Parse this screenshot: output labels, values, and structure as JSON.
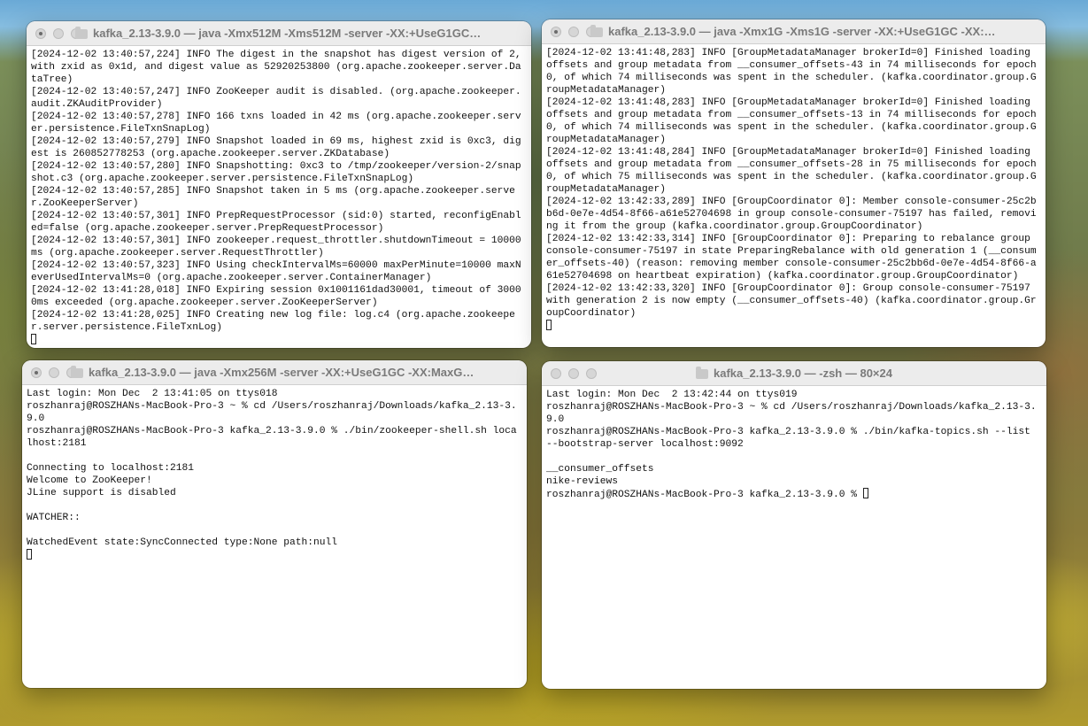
{
  "windows": [
    {
      "title": "kafka_2.13-3.9.0 — java -Xmx512M -Xms512M -server -XX:+UseG1GC -X...",
      "lines": [
        "[2024-12-02 13:40:57,224] INFO The digest in the snapshot has digest version of 2, with zxid as 0x1d, and digest value as 52920253800 (org.apache.zookeeper.server.DataTree)",
        "[2024-12-02 13:40:57,247] INFO ZooKeeper audit is disabled. (org.apache.zookeeper.audit.ZKAuditProvider)",
        "[2024-12-02 13:40:57,278] INFO 166 txns loaded in 42 ms (org.apache.zookeeper.server.persistence.FileTxnSnapLog)",
        "[2024-12-02 13:40:57,279] INFO Snapshot loaded in 69 ms, highest zxid is 0xc3, digest is 260852778253 (org.apache.zookeeper.server.ZKDatabase)",
        "[2024-12-02 13:40:57,280] INFO Snapshotting: 0xc3 to /tmp/zookeeper/version-2/snapshot.c3 (org.apache.zookeeper.server.persistence.FileTxnSnapLog)",
        "[2024-12-02 13:40:57,285] INFO Snapshot taken in 5 ms (org.apache.zookeeper.server.ZooKeeperServer)",
        "[2024-12-02 13:40:57,301] INFO PrepRequestProcessor (sid:0) started, reconfigEnabled=false (org.apache.zookeeper.server.PrepRequestProcessor)",
        "[2024-12-02 13:40:57,301] INFO zookeeper.request_throttler.shutdownTimeout = 10000 ms (org.apache.zookeeper.server.RequestThrottler)",
        "[2024-12-02 13:40:57,323] INFO Using checkIntervalMs=60000 maxPerMinute=10000 maxNeverUsedIntervalMs=0 (org.apache.zookeeper.server.ContainerManager)",
        "[2024-12-02 13:41:28,018] INFO Expiring session 0x1001161dad30001, timeout of 30000ms exceeded (org.apache.zookeeper.server.ZooKeeperServer)",
        "[2024-12-02 13:41:28,025] INFO Creating new log file: log.c4 (org.apache.zookeeper.server.persistence.FileTxnLog)"
      ]
    },
    {
      "title": "kafka_2.13-3.9.0 — java -Xmx1G -Xms1G -server -XX:+UseG1GC -XX:Max...",
      "lines": [
        "[2024-12-02 13:41:48,283] INFO [GroupMetadataManager brokerId=0] Finished loading offsets and group metadata from __consumer_offsets-43 in 74 milliseconds for epoch 0, of which 74 milliseconds was spent in the scheduler. (kafka.coordinator.group.GroupMetadataManager)",
        "[2024-12-02 13:41:48,283] INFO [GroupMetadataManager brokerId=0] Finished loading offsets and group metadata from __consumer_offsets-13 in 74 milliseconds for epoch 0, of which 74 milliseconds was spent in the scheduler. (kafka.coordinator.group.GroupMetadataManager)",
        "[2024-12-02 13:41:48,284] INFO [GroupMetadataManager brokerId=0] Finished loading offsets and group metadata from __consumer_offsets-28 in 75 milliseconds for epoch 0, of which 75 milliseconds was spent in the scheduler. (kafka.coordinator.group.GroupMetadataManager)",
        "[2024-12-02 13:42:33,289] INFO [GroupCoordinator 0]: Member console-consumer-25c2bb6d-0e7e-4d54-8f66-a61e52704698 in group console-consumer-75197 has failed, removing it from the group (kafka.coordinator.group.GroupCoordinator)",
        "[2024-12-02 13:42:33,314] INFO [GroupCoordinator 0]: Preparing to rebalance group console-consumer-75197 in state PreparingRebalance with old generation 1 (__consumer_offsets-40) (reason: removing member console-consumer-25c2bb6d-0e7e-4d54-8f66-a61e52704698 on heartbeat expiration) (kafka.coordinator.group.GroupCoordinator)",
        "[2024-12-02 13:42:33,320] INFO [GroupCoordinator 0]: Group console-consumer-75197 with generation 2 is now empty (__consumer_offsets-40) (kafka.coordinator.group.GroupCoordinator)"
      ]
    },
    {
      "title": "kafka_2.13-3.9.0 — java -Xmx256M -server -XX:+UseG1GC -XX:MaxGCP...",
      "lines": [
        "Last login: Mon Dec  2 13:41:05 on ttys018",
        "roszhanraj@ROSZHANs-MacBook-Pro-3 ~ % cd /Users/roszhanraj/Downloads/kafka_2.13-3.9.0",
        "roszhanraj@ROSZHANs-MacBook-Pro-3 kafka_2.13-3.9.0 % ./bin/zookeeper-shell.sh localhost:2181",
        "",
        "Connecting to localhost:2181",
        "Welcome to ZooKeeper!",
        "JLine support is disabled",
        "",
        "WATCHER::",
        "",
        "WatchedEvent state:SyncConnected type:None path:null"
      ]
    },
    {
      "title": "kafka_2.13-3.9.0 — -zsh — 80×24",
      "lines": [
        "Last login: Mon Dec  2 13:42:44 on ttys019",
        "roszhanraj@ROSZHANs-MacBook-Pro-3 ~ % cd /Users/roszhanraj/Downloads/kafka_2.13-3.9.0",
        "roszhanraj@ROSZHANs-MacBook-Pro-3 kafka_2.13-3.9.0 % ./bin/kafka-topics.sh --list --bootstrap-server localhost:9092",
        "",
        "__consumer_offsets",
        "nike-reviews"
      ],
      "prompt": "roszhanraj@ROSZHANs-MacBook-Pro-3 kafka_2.13-3.9.0 % "
    }
  ]
}
